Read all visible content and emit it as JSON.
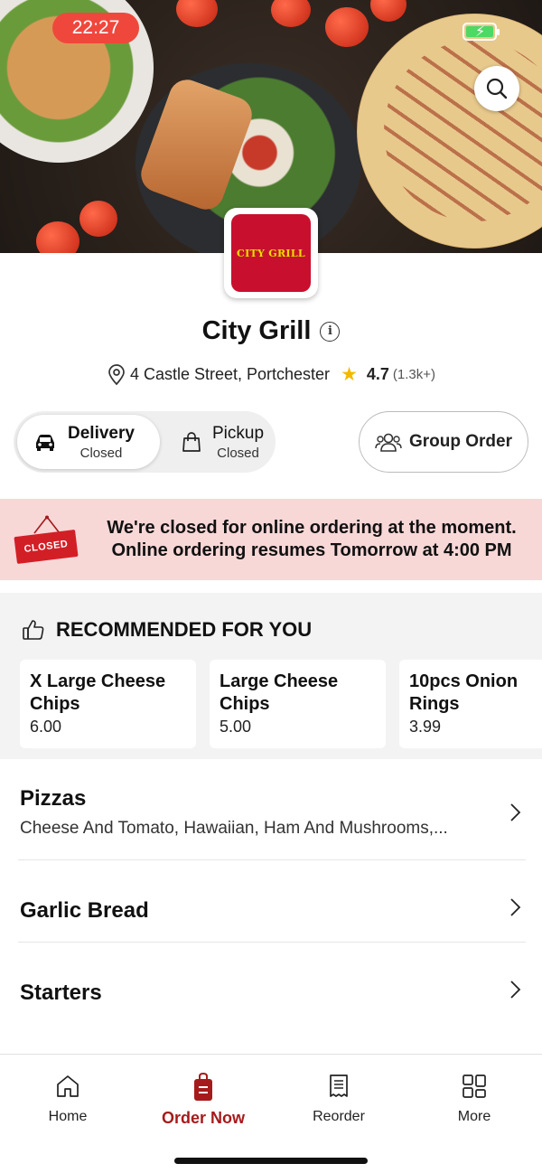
{
  "status_bar": {
    "time": "22:27",
    "battery_icon": "battery-charging-icon"
  },
  "hero": {
    "search_icon": "search-icon"
  },
  "logo": {
    "brand_text": "CITY GRILL",
    "bg_color": "#c8102e",
    "text_color": "#f5d800"
  },
  "restaurant": {
    "name": "City Grill",
    "info_icon_text": "i",
    "address": "4 Castle Street, Portchester",
    "rating": "4.7",
    "rating_count": "(1.3k+)"
  },
  "order_mode": {
    "delivery": {
      "label": "Delivery",
      "status": "Closed",
      "selected": true
    },
    "pickup": {
      "label": "Pickup",
      "status": "Closed",
      "selected": false
    },
    "group_order_label": "Group Order"
  },
  "closed_banner": {
    "sign_text": "CLOSED",
    "line1": "We're closed for online ordering at the moment.",
    "line2": "Online ordering resumes Tomorrow at 4:00 PM",
    "bg_color": "#f8d7d7"
  },
  "recommended": {
    "title": "RECOMMENDED FOR YOU",
    "items": [
      {
        "name_line1": "X Large Cheese",
        "name_line2": "Chips",
        "price": "6.00"
      },
      {
        "name_line1": "Large Cheese",
        "name_line2": "Chips",
        "price": "5.00"
      },
      {
        "name_line1": "10pcs Onion",
        "name_line2": "Rings",
        "price": "3.99"
      }
    ]
  },
  "categories": [
    {
      "title": "Pizzas",
      "subtitle": "Cheese And Tomato, Hawaiian, Ham And Mushrooms,..."
    },
    {
      "title": "Garlic Bread",
      "subtitle": ""
    },
    {
      "title": "Starters",
      "subtitle": ""
    }
  ],
  "bottom_nav": {
    "active_color": "#a51b1b",
    "items": [
      {
        "label": "Home",
        "icon": "home-icon"
      },
      {
        "label": "Order Now",
        "icon": "order-bag-icon",
        "active": true
      },
      {
        "label": "Reorder",
        "icon": "receipt-icon"
      },
      {
        "label": "More",
        "icon": "grid-icon"
      }
    ]
  }
}
